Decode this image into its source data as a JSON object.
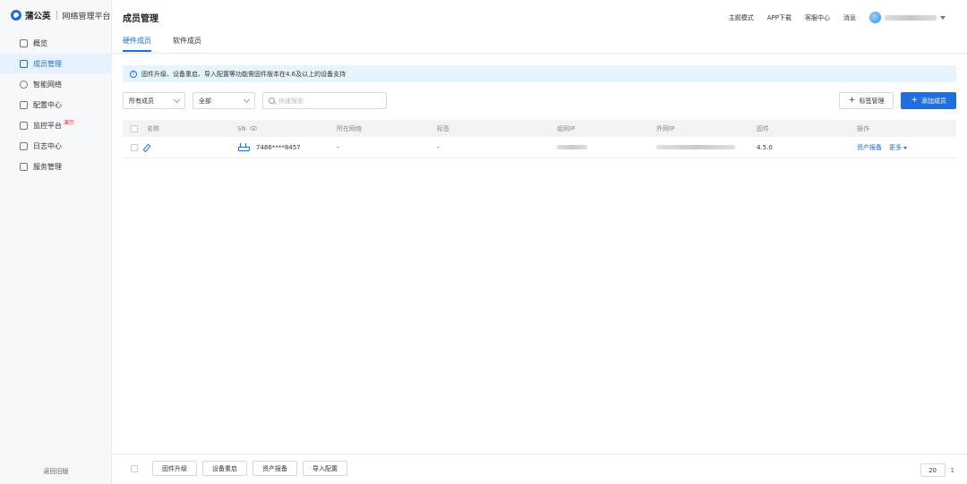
{
  "brand": {
    "name": "蒲公英",
    "subtitle": "网络管理平台"
  },
  "sidebar": {
    "items": [
      {
        "label": "概览",
        "icon": "home-icon",
        "active": false
      },
      {
        "label": "成员管理",
        "icon": "layers-icon",
        "active": true
      },
      {
        "label": "智能网络",
        "icon": "network-icon",
        "active": false
      },
      {
        "label": "配置中心",
        "icon": "grid-icon",
        "active": false
      },
      {
        "label": "监控平台",
        "icon": "monitor-icon",
        "active": false,
        "badge": "演示"
      },
      {
        "label": "日志中心",
        "icon": "log-icon",
        "active": false
      },
      {
        "label": "服务管理",
        "icon": "service-icon",
        "active": false
      }
    ],
    "collapse_label": "返回旧版"
  },
  "header": {
    "title": "成员管理",
    "tabs": [
      {
        "label": "硬件成员",
        "active": true
      },
      {
        "label": "软件成员",
        "active": false
      }
    ],
    "topnav": [
      "主题模式",
      "APP下载",
      "客服中心",
      "消息"
    ]
  },
  "notice": {
    "text": "固件升级、设备重启、导入配置等功能需固件版本在4.6及以上的设备支持"
  },
  "filters": {
    "member_select": "所有成员",
    "status_select": "全部",
    "search_placeholder": "快速搜索"
  },
  "actions": {
    "tag_manage": "标签管理",
    "add_member": "添加成员"
  },
  "table": {
    "columns": [
      "名称",
      "SN",
      "所在网络",
      "标签",
      "组网IP",
      "外网IP",
      "固件",
      "操作"
    ],
    "rows": [
      {
        "name": "",
        "sn": "7486****8457",
        "network": "-",
        "tag": "-",
        "lan_ip": "",
        "wan_ip": "",
        "firmware": "4.5.0",
        "op_report": "资产报备",
        "op_more": "更多"
      }
    ]
  },
  "bottom": {
    "buttons": [
      "固件升级",
      "设备重启",
      "资产报备",
      "导入配置"
    ],
    "page_size": "20",
    "current_page": "1"
  }
}
